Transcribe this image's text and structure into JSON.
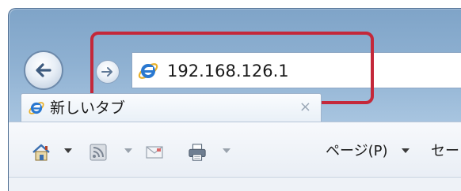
{
  "address_bar": {
    "url": "192.168.126.1",
    "icon": "ie-logo-icon"
  },
  "tab": {
    "label": "新しいタブ",
    "close_label": "×",
    "icon": "ie-logo-icon"
  },
  "navigation": {
    "back_icon": "arrow-left-icon",
    "forward_icon": "arrow-right-icon"
  },
  "command_bar": {
    "home_icon": "home-icon",
    "feeds_icon": "rss-feed-icon",
    "mail_icon": "mail-icon",
    "print_icon": "printer-icon",
    "page_menu_label": "ページ(P)",
    "safety_menu_label": "セー"
  },
  "colors": {
    "highlight": "#c4283a",
    "frame": "#8fb1d2",
    "ie_blue": "#2a78d0",
    "ie_gold": "#e8b02a"
  }
}
